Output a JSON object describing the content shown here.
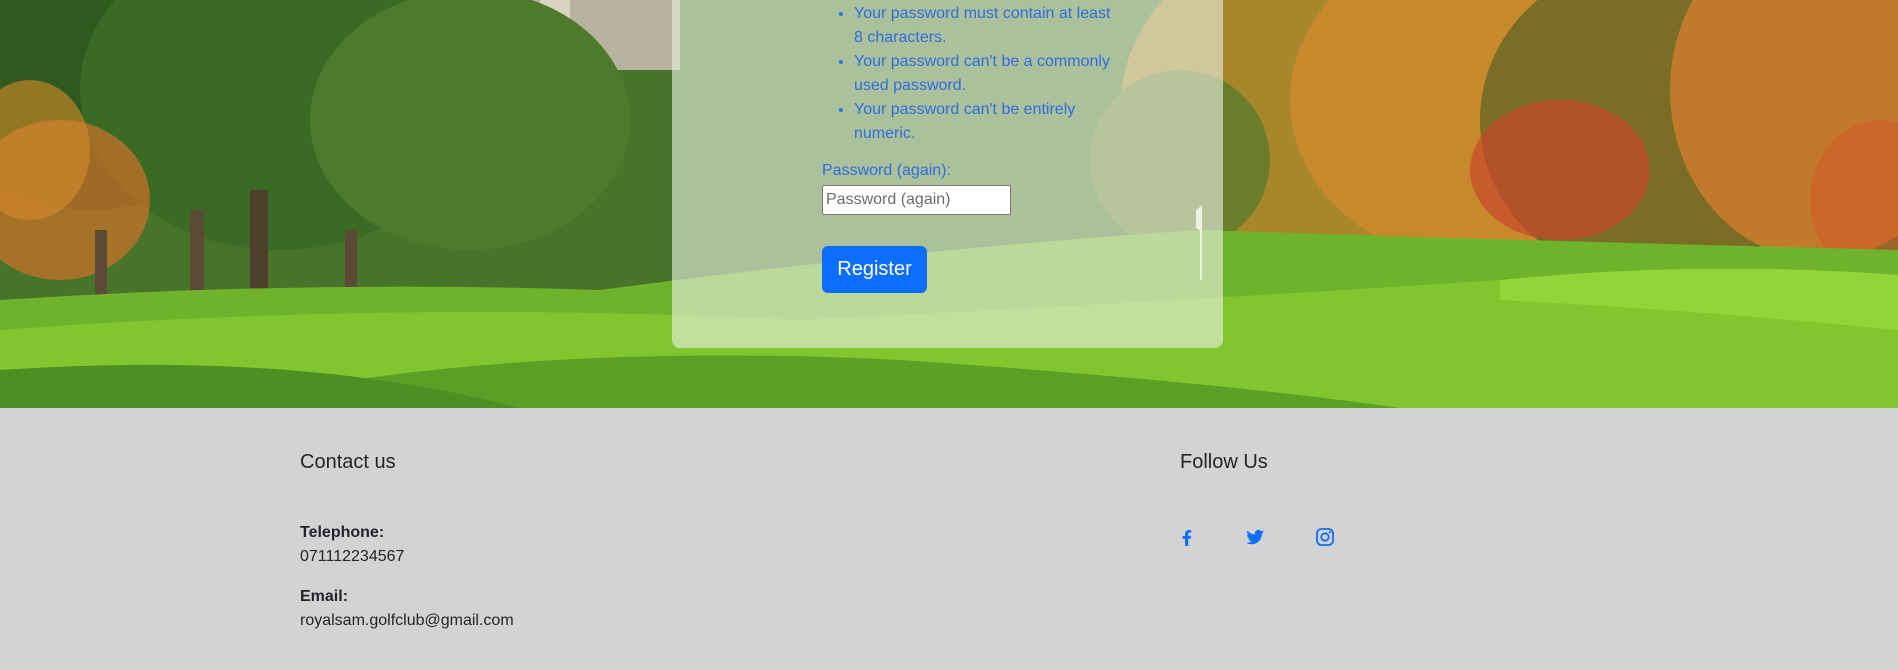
{
  "form": {
    "help_items": [
      "Your password must contain at least 8 characters.",
      "Your password can't be a commonly used password.",
      "Your password can't be entirely numeric."
    ],
    "password_again_label": "Password (again):",
    "password_again_placeholder": "Password (again)",
    "register_label": "Register"
  },
  "footer": {
    "contact_title": "Contact us",
    "telephone_label": "Telephone:",
    "telephone_value": "071112234567",
    "email_label": "Email:",
    "email_value": "royalsam.golfclub@gmail.com",
    "follow_title": "Follow Us",
    "social": [
      {
        "name": "facebook-icon"
      },
      {
        "name": "twitter-icon"
      },
      {
        "name": "instagram-icon"
      }
    ]
  },
  "colors": {
    "accent": "#0d6efd",
    "help_text": "#2f6de0",
    "footer_bg": "#d3d3d3"
  }
}
